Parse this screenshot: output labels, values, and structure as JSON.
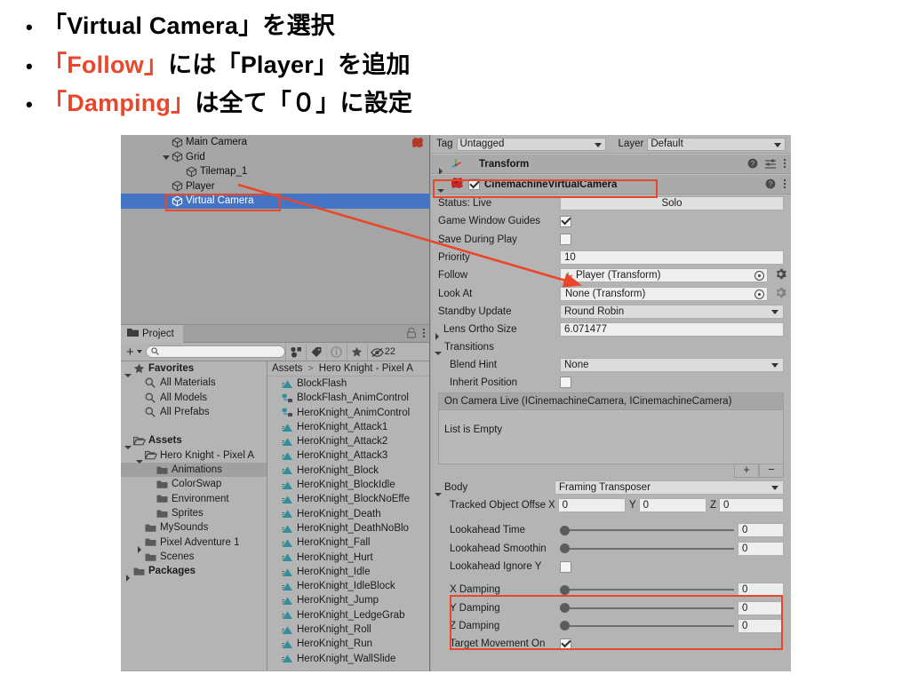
{
  "slide": {
    "bullets": [
      {
        "marker": "•",
        "segments": [
          {
            "text": "「Virtual Camera」を選択",
            "accent": false
          }
        ]
      },
      {
        "marker": "•",
        "segments": [
          {
            "text": "「Follow」",
            "accent": true
          },
          {
            "text": "には「Player」を追加",
            "accent": false
          }
        ]
      },
      {
        "marker": "•",
        "segments": [
          {
            "text": "「Damping」",
            "accent": true
          },
          {
            "text": "は全て「０」に設定",
            "accent": false
          }
        ]
      }
    ],
    "bullet_1_text": "「Virtual Camera」を選択",
    "bullet_2_accent": "「Follow」",
    "bullet_2_rest": "には「Player」を追加",
    "bullet_3_accent": "「Damping」",
    "bullet_3_rest": "は全て「０」に設定",
    "accent_color": "#E8472B"
  },
  "hierarchy": {
    "items": [
      {
        "label": "Main Camera",
        "depth": 1,
        "expandable": false,
        "selected": false,
        "icon": "gameobject-cube-icon",
        "extra_icon": "cinemachine-brain-icon"
      },
      {
        "label": "Grid",
        "depth": 1,
        "expandable": true,
        "selected": false,
        "icon": "gameobject-cube-icon"
      },
      {
        "label": "Tilemap_1",
        "depth": 2,
        "expandable": false,
        "selected": false,
        "icon": "gameobject-cube-icon"
      },
      {
        "label": "Player",
        "depth": 1,
        "expandable": false,
        "selected": false,
        "icon": "gameobject-cube-icon"
      },
      {
        "label": "Virtual Camera",
        "depth": 1,
        "expandable": false,
        "selected": true,
        "icon": "gameobject-cube-icon"
      }
    ],
    "selection_color": "#4574c4"
  },
  "project": {
    "tab_label": "Project",
    "search_placeholder": "",
    "hidden_count": "22",
    "breadcrumb": {
      "root": "Assets",
      "separator": ">",
      "current": "Hero Knight - Pixel A"
    },
    "tree": [
      {
        "label": "Favorites",
        "depth": 0,
        "icon": "star-icon",
        "bold": true,
        "tri": "open",
        "selected": false
      },
      {
        "label": "All Materials",
        "depth": 1,
        "icon": "search-icon",
        "bold": false,
        "tri": "none",
        "selected": false
      },
      {
        "label": "All Models",
        "depth": 1,
        "icon": "search-icon",
        "bold": false,
        "tri": "none",
        "selected": false
      },
      {
        "label": "All Prefabs",
        "depth": 1,
        "icon": "search-icon",
        "bold": false,
        "tri": "none",
        "selected": false
      },
      {
        "label": "",
        "depth": 0,
        "icon": "none",
        "bold": false,
        "tri": "none",
        "selected": false
      },
      {
        "label": "Assets",
        "depth": 0,
        "icon": "folder-open-icon",
        "bold": true,
        "tri": "open",
        "selected": false
      },
      {
        "label": "Hero Knight - Pixel A",
        "depth": 1,
        "icon": "folder-open-icon",
        "bold": false,
        "tri": "open",
        "selected": false
      },
      {
        "label": "Animations",
        "depth": 2,
        "icon": "folder-icon",
        "bold": false,
        "tri": "none",
        "selected": true
      },
      {
        "label": "ColorSwap",
        "depth": 2,
        "icon": "folder-icon",
        "bold": false,
        "tri": "none",
        "selected": false
      },
      {
        "label": "Environment",
        "depth": 2,
        "icon": "folder-icon",
        "bold": false,
        "tri": "none",
        "selected": false
      },
      {
        "label": "Sprites",
        "depth": 2,
        "icon": "folder-icon",
        "bold": false,
        "tri": "none",
        "selected": false
      },
      {
        "label": "MySounds",
        "depth": 1,
        "icon": "folder-icon",
        "bold": false,
        "tri": "none",
        "selected": false
      },
      {
        "label": "Pixel Adventure 1",
        "depth": 1,
        "icon": "folder-icon",
        "bold": false,
        "tri": "closed",
        "selected": false
      },
      {
        "label": "Scenes",
        "depth": 1,
        "icon": "folder-icon",
        "bold": false,
        "tri": "none",
        "selected": false
      },
      {
        "label": "Packages",
        "depth": 0,
        "icon": "folder-icon",
        "bold": true,
        "tri": "closed",
        "selected": false
      }
    ],
    "assets": [
      {
        "label": "BlockFlash",
        "icon": "animation-clip-icon"
      },
      {
        "label": "BlockFlash_AnimControl",
        "icon": "animator-controller-icon"
      },
      {
        "label": "HeroKnight_AnimControl",
        "icon": "animator-controller-icon"
      },
      {
        "label": "HeroKnight_Attack1",
        "icon": "animation-clip-icon"
      },
      {
        "label": "HeroKnight_Attack2",
        "icon": "animation-clip-icon"
      },
      {
        "label": "HeroKnight_Attack3",
        "icon": "animation-clip-icon"
      },
      {
        "label": "HeroKnight_Block",
        "icon": "animation-clip-icon"
      },
      {
        "label": "HeroKnight_BlockIdle",
        "icon": "animation-clip-icon"
      },
      {
        "label": "HeroKnight_BlockNoEffe",
        "icon": "animation-clip-icon"
      },
      {
        "label": "HeroKnight_Death",
        "icon": "animation-clip-icon"
      },
      {
        "label": "HeroKnight_DeathNoBlo",
        "icon": "animation-clip-icon"
      },
      {
        "label": "HeroKnight_Fall",
        "icon": "animation-clip-icon"
      },
      {
        "label": "HeroKnight_Hurt",
        "icon": "animation-clip-icon"
      },
      {
        "label": "HeroKnight_Idle",
        "icon": "animation-clip-icon"
      },
      {
        "label": "HeroKnight_IdleBlock",
        "icon": "animation-clip-icon"
      },
      {
        "label": "HeroKnight_Jump",
        "icon": "animation-clip-icon"
      },
      {
        "label": "HeroKnight_LedgeGrab",
        "icon": "animation-clip-icon"
      },
      {
        "label": "HeroKnight_Roll",
        "icon": "animation-clip-icon"
      },
      {
        "label": "HeroKnight_Run",
        "icon": "animation-clip-icon"
      },
      {
        "label": "HeroKnight_WallSlide",
        "icon": "animation-clip-icon"
      }
    ]
  },
  "inspector": {
    "tag_label": "Tag",
    "tag_value": "Untagged",
    "layer_label": "Layer",
    "layer_value": "Default",
    "transform": {
      "title": "Transform"
    },
    "component": {
      "title": "CinemachineVirtualCamera",
      "enabled": true
    },
    "status_label": "Status: Live",
    "solo_button": "Solo",
    "game_window_guides_label": "Game Window Guides",
    "game_window_guides_checked": true,
    "save_during_play_label": "Save During Play",
    "save_during_play_checked": false,
    "priority_label": "Priority",
    "priority_value": "10",
    "follow_label": "Follow",
    "follow_value": "Player (Transform)",
    "look_at_label": "Look At",
    "look_at_value": "None (Transform)",
    "standby_update_label": "Standby Update",
    "standby_update_value": "Round Robin",
    "lens_ortho_size_label": "Lens Ortho Size",
    "lens_ortho_size_value": "6.071477",
    "transitions_label": "Transitions",
    "blend_hint_label": "Blend Hint",
    "blend_hint_value": "None",
    "inherit_position_label": "Inherit Position",
    "inherit_position_checked": false,
    "event_list_header": "On Camera Live (ICinemachineCamera, ICinemachineCamera)",
    "event_list_empty": "List is Empty",
    "event_add": "+",
    "event_remove": "−",
    "body_label": "Body",
    "body_value": "Framing Transposer",
    "tracked_offset_label": "Tracked Object Offse",
    "tracked_offset": {
      "x_label": "X",
      "x": "0",
      "y_label": "Y",
      "y": "0",
      "z_label": "Z",
      "z": "0"
    },
    "lookahead_time_label": "Lookahead Time",
    "lookahead_time_value": "0",
    "lookahead_smoothing_label": "Lookahead Smoothin",
    "lookahead_smoothing_value": "0",
    "lookahead_ignore_y_label": "Lookahead Ignore Y",
    "lookahead_ignore_y_checked": false,
    "x_damping_label": "X Damping",
    "x_damping_value": "0",
    "y_damping_label": "Y Damping",
    "y_damping_value": "0",
    "z_damping_label": "Z Damping",
    "z_damping_value": "0",
    "target_movement_label": "Target Movement On",
    "target_movement_checked": true
  }
}
